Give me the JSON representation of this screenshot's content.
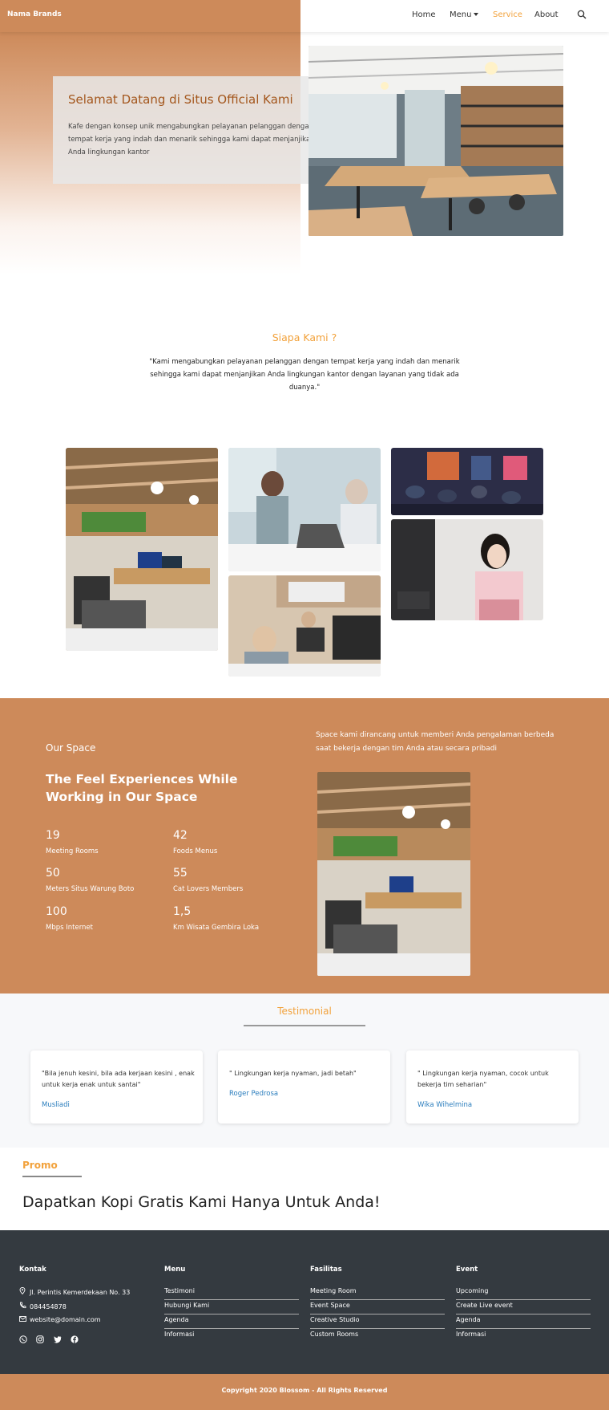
{
  "navbar": {
    "brand": "Nama Brands",
    "items": [
      {
        "label": "Home"
      },
      {
        "label": "Menu"
      },
      {
        "label": "Service"
      },
      {
        "label": "About"
      }
    ],
    "search_icon": "search-icon",
    "brand_color": "#cd8a5a",
    "active_color": "#f2a23c"
  },
  "hero": {
    "title": "Selamat Datang di Situs Official Kami",
    "text": "Kafe dengan konsep unik mengabungkan pelayanan pelanggan dengan tempat kerja yang indah dan menarik sehingga kami dapat menjanjikan Anda lingkungan kantor"
  },
  "about": {
    "title": "Siapa Kami ?",
    "quote": "\"Kami mengabungkan pelayanan pelanggan dengan tempat kerja yang indah dan menarik sehingga kami dapat menjanjikan Anda lingkungan kantor dengan layanan yang tidak ada duanya.\""
  },
  "space": {
    "label": "Our Space",
    "heading": "The Feel Experiences While Working in Our Space",
    "description": "Space kami dirancang untuk memberi Anda pengalaman berbeda saat bekerja dengan tim Anda atau secara pribadi",
    "stats": [
      {
        "value": "19",
        "label": "Meeting Rooms"
      },
      {
        "value": "42",
        "label": "Foods Menus"
      },
      {
        "value": "50",
        "label": "Meters Situs Warung Boto"
      },
      {
        "value": "55",
        "label": "Cat Lovers Members"
      },
      {
        "value": "100",
        "label": "Mbps Internet"
      },
      {
        "value": "1,5",
        "label": "Km Wisata Gembira Loka"
      }
    ]
  },
  "testimonial": {
    "title": "Testimonial",
    "items": [
      {
        "text": "\"Bila jenuh kesini, bila ada kerjaan kesini , enak untuk kerja enak untuk santai\"",
        "author": "Musliadi"
      },
      {
        "text": "\" Lingkungan kerja nyaman, jadi betah\"",
        "author": "Roger Pedrosa"
      },
      {
        "text": "\" Lingkungan kerja nyaman, cocok untuk bekerja tim seharian\"",
        "author": "Wika Wihelmina"
      }
    ]
  },
  "promo": {
    "title": "Promo",
    "heading": "Dapatkan Kopi Gratis Kami Hanya Untuk Anda!"
  },
  "footer": {
    "kontak": {
      "title": "Kontak",
      "address": "Jl. Perintis Kemerdekaan No. 33",
      "phone": "084454878",
      "email": "website@domain.com",
      "social_icons": [
        "whatsapp-icon",
        "instagram-icon",
        "twitter-icon",
        "facebook-icon"
      ]
    },
    "menu": {
      "title": "Menu",
      "items": [
        "Testimoni",
        "Hubungi Kami",
        "Agenda",
        "Informasi"
      ]
    },
    "fasilitas": {
      "title": "Fasilitas",
      "items": [
        "Meeting Room",
        "Event Space",
        "Creative Studio",
        "Custom Rooms"
      ]
    },
    "event": {
      "title": "Event",
      "items": [
        "Upcoming",
        "Create Live event",
        "Agenda",
        "Informasi"
      ]
    },
    "copyright": "Copyright 2020 Blossom - All Rights Reserved"
  }
}
